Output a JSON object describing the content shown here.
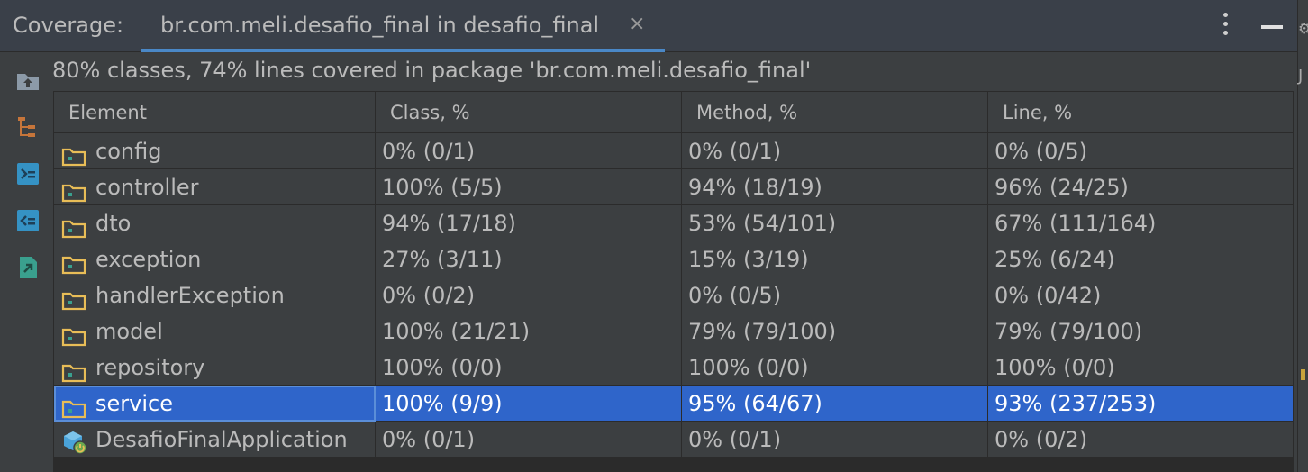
{
  "header": {
    "title": "Coverage:",
    "tab_label": "br.com.meli.desafio_final in desafio_final",
    "tab_close": "×"
  },
  "summary": "80% classes, 74% lines covered in package 'br.com.meli.desafio_final'",
  "table": {
    "columns": [
      "Element",
      "Class, %",
      "Method, %",
      "Line, %"
    ],
    "rows": [
      {
        "element": "config",
        "class": "0% (0/1)",
        "method": "0% (0/1)",
        "line": "0% (0/5)",
        "icon": "folder-icon",
        "selected": false
      },
      {
        "element": "controller",
        "class": "100% (5/5)",
        "method": "94% (18/19)",
        "line": "96% (24/25)",
        "icon": "folder-icon",
        "selected": false
      },
      {
        "element": "dto",
        "class": "94% (17/18)",
        "method": "53% (54/101)",
        "line": "67% (111/164)",
        "icon": "folder-icon",
        "selected": false
      },
      {
        "element": "exception",
        "class": "27% (3/11)",
        "method": "15% (3/19)",
        "line": "25% (6/24)",
        "icon": "folder-icon",
        "selected": false
      },
      {
        "element": "handlerException",
        "class": "0% (0/2)",
        "method": "0% (0/5)",
        "line": "0% (0/42)",
        "icon": "folder-icon",
        "selected": false
      },
      {
        "element": "model",
        "class": "100% (21/21)",
        "method": "79% (79/100)",
        "line": "79% (79/100)",
        "icon": "folder-icon",
        "selected": false
      },
      {
        "element": "repository",
        "class": "100% (0/0)",
        "method": "100% (0/0)",
        "line": "100% (0/0)",
        "icon": "folder-icon",
        "selected": false
      },
      {
        "element": "service",
        "class": "100% (9/9)",
        "method": "95% (64/67)",
        "line": "93% (237/253)",
        "icon": "folder-icon",
        "selected": true
      },
      {
        "element": "DesafioFinalApplication",
        "class": "0% (0/1)",
        "method": "0% (0/1)",
        "line": "0% (0/2)",
        "icon": "spring-boot-app-icon",
        "selected": false
      }
    ]
  },
  "colors": {
    "background": "#3c3f41",
    "header": "#3a4049",
    "selection": "#2f65ca",
    "tab_underline": "#4a88c7",
    "folder": "#e8bd57"
  }
}
